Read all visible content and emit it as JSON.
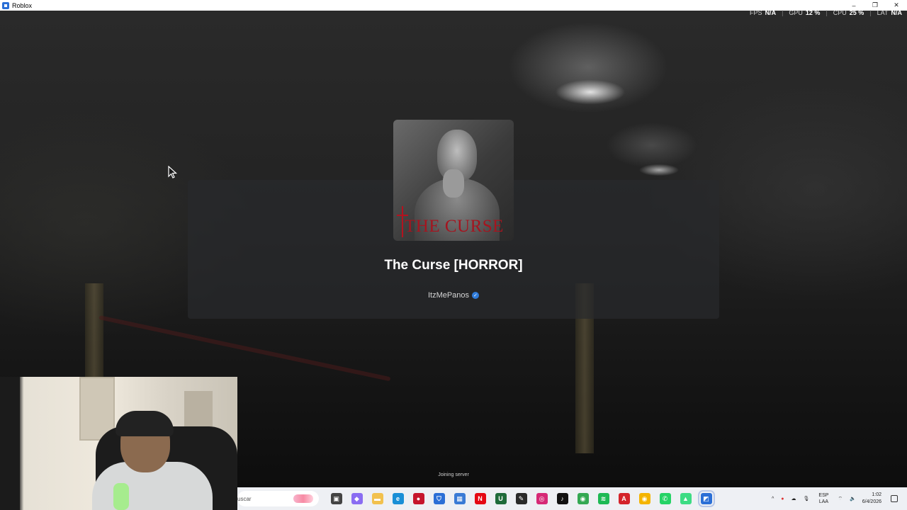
{
  "window": {
    "title": "Roblox",
    "controls": [
      "–",
      "❐",
      "✕"
    ]
  },
  "perf": {
    "fps_label": "FPS",
    "fps_value": "N/A",
    "gpu_label": "GPU",
    "gpu_value": "12 %",
    "cpu_label": "CPU",
    "cpu_value": "25 %",
    "lat_label": "LAT",
    "lat_value": "N/A",
    "separator": "|"
  },
  "game": {
    "thumbnail_text": "THE CURSE",
    "title": "The Curse [HORROR]",
    "creator": "ItzMePanos",
    "verified_mark": "✓"
  },
  "status": {
    "joining": "Joining server"
  },
  "taskbar": {
    "search_placeholder": "uscar",
    "icons": [
      {
        "name": "task-view-icon",
        "glyph": "▣",
        "color": "#444444"
      },
      {
        "name": "copilot-icon",
        "glyph": "◆",
        "color": "#8a6df2"
      },
      {
        "name": "file-explorer-icon",
        "glyph": "▬",
        "color": "#f2c14e"
      },
      {
        "name": "edge-icon",
        "glyph": "e",
        "color": "#1a8fd6"
      },
      {
        "name": "app-red-icon",
        "glyph": "●",
        "color": "#c6152c"
      },
      {
        "name": "security-shield-icon",
        "glyph": "⛉",
        "color": "#2b6fd6"
      },
      {
        "name": "store-icon",
        "glyph": "▦",
        "color": "#3a7bd5"
      },
      {
        "name": "netflix-icon",
        "glyph": "N",
        "color": "#e50914"
      },
      {
        "name": "upwork-icon",
        "glyph": "U",
        "color": "#1f6b3a"
      },
      {
        "name": "notes-icon",
        "glyph": "✎",
        "color": "#2a2a2a"
      },
      {
        "name": "instagram-icon",
        "glyph": "◎",
        "color": "#d62976"
      },
      {
        "name": "tiktok-icon",
        "glyph": "♪",
        "color": "#111111"
      },
      {
        "name": "chrome-icon",
        "glyph": "◉",
        "color": "#34a853"
      },
      {
        "name": "spotify-icon",
        "glyph": "≋",
        "color": "#1db954"
      },
      {
        "name": "acrobat-icon",
        "glyph": "A",
        "color": "#d4232b"
      },
      {
        "name": "chrome-alt-icon",
        "glyph": "◉",
        "color": "#f4b400"
      },
      {
        "name": "whatsapp-icon",
        "glyph": "✆",
        "color": "#25d366"
      },
      {
        "name": "android-icon",
        "glyph": "▲",
        "color": "#3ddc84"
      },
      {
        "name": "roblox-icon",
        "glyph": "◩",
        "color": "#2b6fd6"
      }
    ],
    "tray": {
      "chevron": "^",
      "lang_top": "ESP",
      "lang_bottom": "LAA",
      "time": "1:02",
      "date": "6/4/2026"
    }
  }
}
